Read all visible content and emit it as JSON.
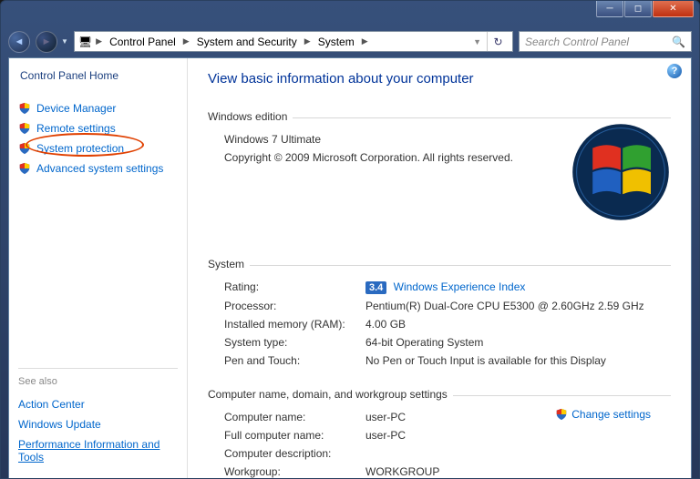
{
  "breadcrumbs": {
    "root_icon": "computer",
    "items": [
      "Control Panel",
      "System and Security",
      "System"
    ]
  },
  "search": {
    "placeholder": "Search Control Panel"
  },
  "sidebar": {
    "home": "Control Panel Home",
    "links": [
      {
        "label": "Device Manager",
        "shield": false
      },
      {
        "label": "Remote settings",
        "shield": true
      },
      {
        "label": "System protection",
        "shield": true,
        "circled": true
      },
      {
        "label": "Advanced system settings",
        "shield": true
      }
    ],
    "seealso_title": "See also",
    "seealso": [
      {
        "label": "Action Center"
      },
      {
        "label": "Windows Update"
      },
      {
        "label": "Performance Information and Tools",
        "underline": true
      }
    ]
  },
  "main": {
    "title": "View basic information about your computer",
    "edition": {
      "heading": "Windows edition",
      "name": "Windows 7 Ultimate",
      "copyright": "Copyright © 2009 Microsoft Corporation.  All rights reserved."
    },
    "system": {
      "heading": "System",
      "rating_label": "Rating:",
      "rating_value": "3.4",
      "rating_link": "Windows Experience Index",
      "rows": [
        {
          "k": "Processor:",
          "v": "Pentium(R) Dual-Core  CPU      E5300   @ 2.60GHz   2.59 GHz"
        },
        {
          "k": "Installed memory (RAM):",
          "v": "4.00 GB"
        },
        {
          "k": "System type:",
          "v": "64-bit Operating System"
        },
        {
          "k": "Pen and Touch:",
          "v": "No Pen or Touch Input is available for this Display"
        }
      ]
    },
    "domain": {
      "heading": "Computer name, domain, and workgroup settings",
      "change_link": "Change settings",
      "rows": [
        {
          "k": "Computer name:",
          "v": "user-PC"
        },
        {
          "k": "Full computer name:",
          "v": "user-PC"
        },
        {
          "k": "Computer description:",
          "v": ""
        },
        {
          "k": "Workgroup:",
          "v": "WORKGROUP"
        }
      ]
    }
  }
}
